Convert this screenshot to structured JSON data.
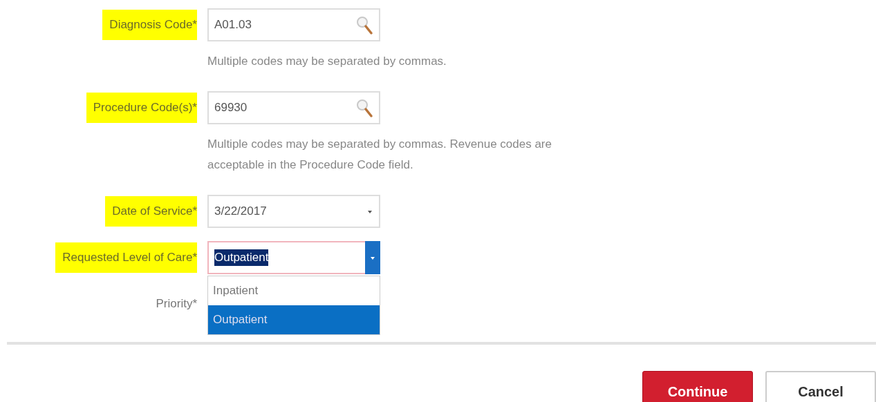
{
  "form_rows": [
    {
      "label": "Diagnosis Code*",
      "highlighted": true,
      "kind": "search",
      "value": "A01.03",
      "hint": "Multiple codes may be separated by commas."
    },
    {
      "label": "Procedure Code(s)*",
      "highlighted": true,
      "kind": "search",
      "value": "69930",
      "hint": "Multiple codes may be separated by commas. Revenue codes are acceptable in the Procedure Code field."
    },
    {
      "label": "Date of Service*",
      "highlighted": true,
      "kind": "date",
      "value": "3/22/2017"
    },
    {
      "label": "Requested Level of Care*",
      "highlighted": true,
      "kind": "select",
      "value": "Outpatient",
      "invalid": true,
      "value_selected": true,
      "expanded": true,
      "options": [
        {
          "label": "Inpatient",
          "selected": false
        },
        {
          "label": "Outpatient",
          "selected": true
        }
      ]
    },
    {
      "label": "Priority*",
      "highlighted": false,
      "kind": "hidden"
    }
  ],
  "buttons": [
    {
      "label": "Continue",
      "kind": "primary"
    },
    {
      "label": "Cancel",
      "kind": "secondary"
    }
  ]
}
